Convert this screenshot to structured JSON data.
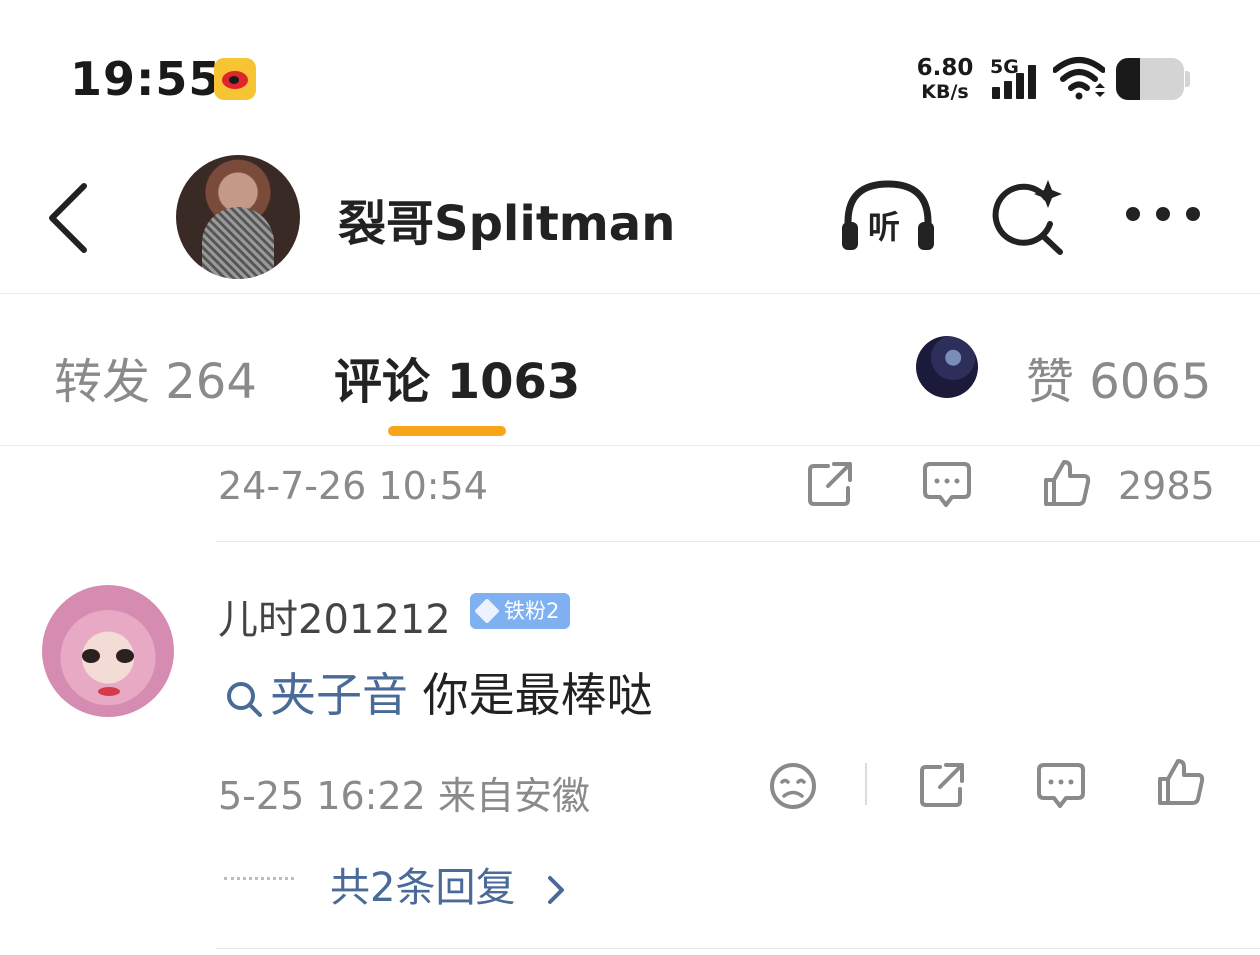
{
  "status_bar": {
    "time": "19:55",
    "app_icon": "weibo-icon",
    "net_speed_value": "6.80",
    "net_speed_unit": "KB/s",
    "network_type": "5G",
    "battery_level": 0.35
  },
  "header": {
    "back_icon": "back-chevron-icon",
    "user_name": "裂哥Splitman",
    "listen_label": "听",
    "search_icon": "ai-search-icon",
    "more_icon": "more-icon"
  },
  "tabs": {
    "repost": "转发 264",
    "comment": "评论 1063",
    "like": "赞 6065",
    "active_color": "#f8a51a"
  },
  "previous_comment_footer": {
    "timestamp": "24-7-26 10:54",
    "like_count": "2985"
  },
  "comment": {
    "user_name": "儿时201212",
    "badge": "铁粉2",
    "topic": "夹子音",
    "text": " 你是最棒哒",
    "timestamp": "5-25 16:22",
    "location": "来自安徽",
    "replies_link": "共2条回复",
    "link_color": "#4a6a98"
  }
}
